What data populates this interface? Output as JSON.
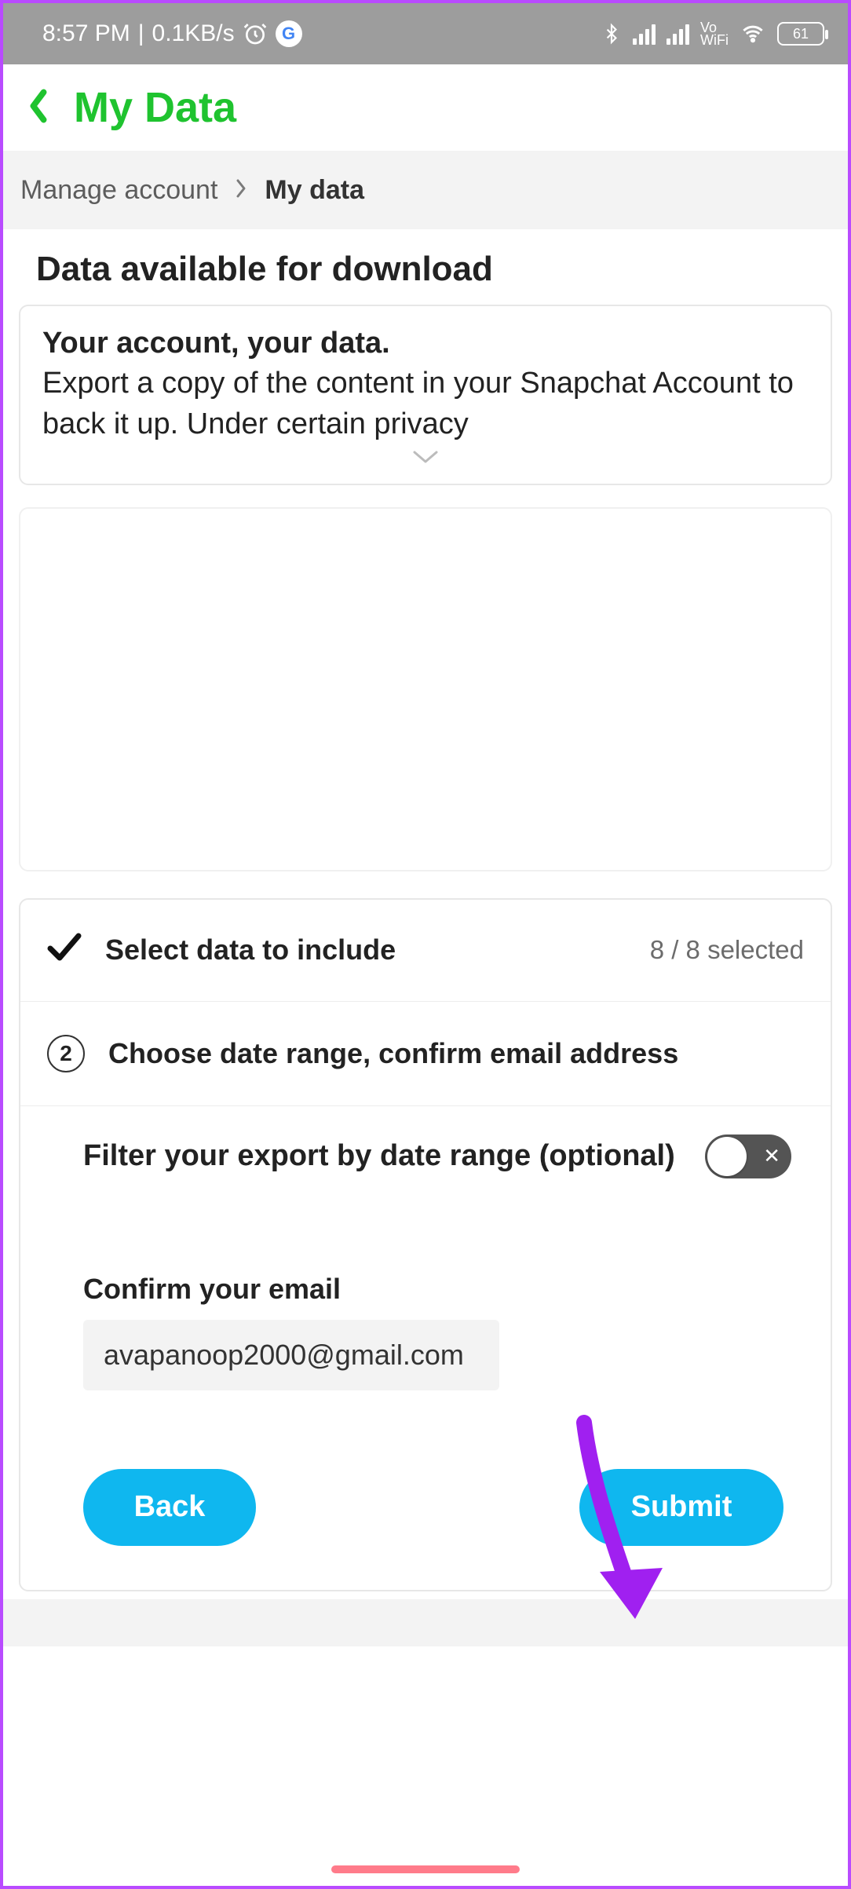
{
  "statusbar": {
    "time": "8:57 PM",
    "net_speed": "0.1KB/s",
    "vo_line1": "Vo",
    "vo_line2": "WiFi",
    "battery": "61"
  },
  "header": {
    "title": "My Data"
  },
  "breadcrumb": {
    "parent": "Manage account",
    "current": "My data"
  },
  "h1": "Data available for download",
  "intro": {
    "heading": "Your account, your data.",
    "body": "Export a copy of the content in your Snapchat Account to back it up. Under certain privacy"
  },
  "steps": {
    "step1_label": "Select data to include",
    "step1_count": "8 / 8 selected",
    "step2_num": "2",
    "step2_label": "Choose date range, confirm email address",
    "filter_label": "Filter your export by date range (optional)",
    "toggle_x": "✕",
    "confirm_label": "Confirm your email",
    "email_value": "avapanoop2000@gmail.com",
    "back_btn": "Back",
    "submit_btn": "Submit"
  }
}
